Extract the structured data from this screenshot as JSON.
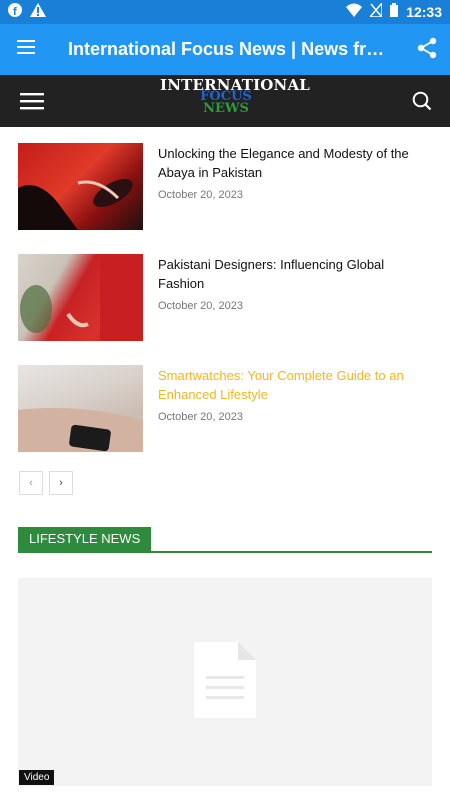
{
  "status_bar": {
    "time": "12:33"
  },
  "app_bar": {
    "title": "International Focus News | News fro..."
  },
  "site_header": {
    "logo_line1": "INTERNATIONAL",
    "logo_line2": "FOCUS",
    "logo_line3": "NEWS"
  },
  "articles": [
    {
      "title": "Unlocking the Elegance and Modesty of the Abaya in Pakistan",
      "date": "October 20, 2023"
    },
    {
      "title": "Pakistani Designers: Influencing Global Fashion",
      "date": "October 20, 2023"
    },
    {
      "title": "Smartwatches: Your Complete Guide to an Enhanced Lifestyle",
      "date": "October 20, 2023"
    }
  ],
  "pager": {
    "prev": "‹",
    "next": "›"
  },
  "section": {
    "label": "LIFESTYLE NEWS"
  },
  "video_card": {
    "tag": "Video"
  },
  "colors": {
    "status_bar": "#1a7fd6",
    "app_bar": "#2196f3",
    "site_header": "#222222",
    "section_accent": "#2e8b3e",
    "highlight": "#f0b81b"
  }
}
